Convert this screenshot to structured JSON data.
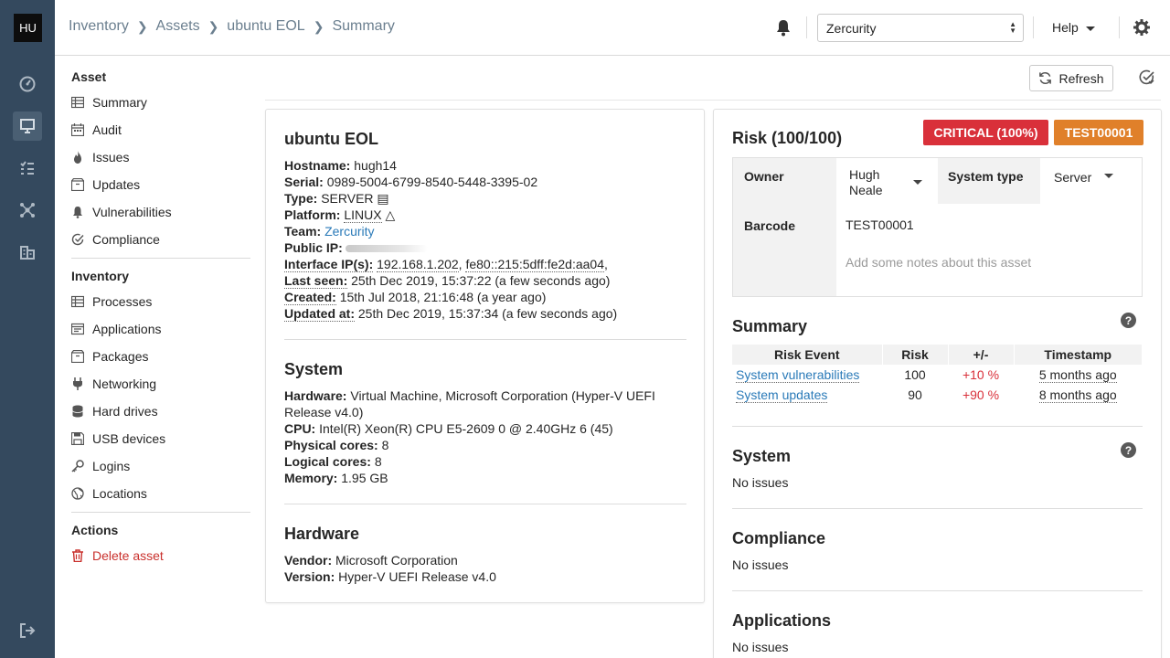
{
  "rail": {
    "logo": "HU",
    "items": [
      {
        "name": "dashboard-icon"
      },
      {
        "name": "assets-icon",
        "active": true
      },
      {
        "name": "tasks-icon"
      },
      {
        "name": "network-icon"
      },
      {
        "name": "organisation-icon"
      },
      {
        "name": "logout-icon"
      }
    ]
  },
  "header": {
    "breadcrumb": [
      "Inventory",
      "Assets",
      "ubuntu EOL",
      "Summary"
    ],
    "tenant": "Zercurity",
    "help": "Help"
  },
  "sidebar": {
    "asset_title": "Asset",
    "asset_items": [
      "Summary",
      "Audit",
      "Issues",
      "Updates",
      "Vulnerabilities",
      "Compliance"
    ],
    "inventory_title": "Inventory",
    "inventory_items": [
      "Processes",
      "Applications",
      "Packages",
      "Networking",
      "Hard drives",
      "USB devices",
      "Logins",
      "Locations"
    ],
    "actions_title": "Actions",
    "delete": "Delete asset"
  },
  "toolbar": {
    "refresh": "Refresh"
  },
  "asset": {
    "title": "ubuntu EOL",
    "hostname_label": "Hostname:",
    "hostname": "hugh14",
    "serial_label": "Serial:",
    "serial": "0989-5004-6799-8540-5448-3395-02",
    "type_label": "Type:",
    "type": "SERVER",
    "platform_label": "Platform:",
    "platform": "LINUX",
    "team_label": "Team:",
    "team": "Zercurity",
    "public_ip_label": "Public IP:",
    "iface_label": "Interface IP(s):",
    "iface_ip1": "192.168.1.202",
    "iface_ip2": "fe80::215:5dff:fe2d:aa04",
    "last_seen_label": "Last seen:",
    "last_seen": "25th Dec 2019, 15:37:22 (a few seconds ago)",
    "created_label": "Created:",
    "created": "15th Jul 2018, 21:16:48 (a year ago)",
    "updated_label": "Updated at:",
    "updated": "25th Dec 2019, 15:37:34 (a few seconds ago)"
  },
  "system": {
    "title": "System",
    "hardware_label": "Hardware:",
    "hardware": "Virtual Machine, Microsoft Corporation (Hyper-V UEFI Release v4.0)",
    "cpu_label": "CPU:",
    "cpu": "Intel(R) Xeon(R) CPU E5-2609 0 @ 2.40GHz 6 (45)",
    "physical_label": "Physical cores:",
    "physical": "8",
    "logical_label": "Logical cores:",
    "logical": "8",
    "memory_label": "Memory:",
    "memory": "1.95 GB"
  },
  "hardware": {
    "title": "Hardware",
    "vendor_label": "Vendor:",
    "vendor": "Microsoft Corporation",
    "version_label": "Version:",
    "version": "Hyper-V UEFI Release v4.0"
  },
  "risk": {
    "title": "Risk (100/100)",
    "critical": "CRITICAL (100%)",
    "tag": "TEST00001",
    "owner_label": "Owner",
    "owner_line1": "Hugh",
    "owner_line2": "Neale",
    "system_type_label": "System type",
    "system_type": "Server",
    "barcode_label": "Barcode",
    "barcode": "TEST00001",
    "notes_placeholder": "Add some notes about this asset",
    "colors": {
      "critical": "#d9303a",
      "tag": "#e0802a"
    }
  },
  "summary": {
    "title": "Summary",
    "headers": [
      "Risk Event",
      "Risk",
      "+/-",
      "Timestamp"
    ],
    "rows": [
      {
        "event": "System vulnerabilities",
        "risk": "100",
        "delta": "+10 %",
        "time": "5 months ago"
      },
      {
        "event": "System updates",
        "risk": "90",
        "delta": "+90 %",
        "time": "8 months ago"
      }
    ]
  },
  "sections": [
    {
      "title": "System",
      "text": "No issues"
    },
    {
      "title": "Compliance",
      "text": "No issues"
    },
    {
      "title": "Applications",
      "text": "No issues"
    }
  ]
}
